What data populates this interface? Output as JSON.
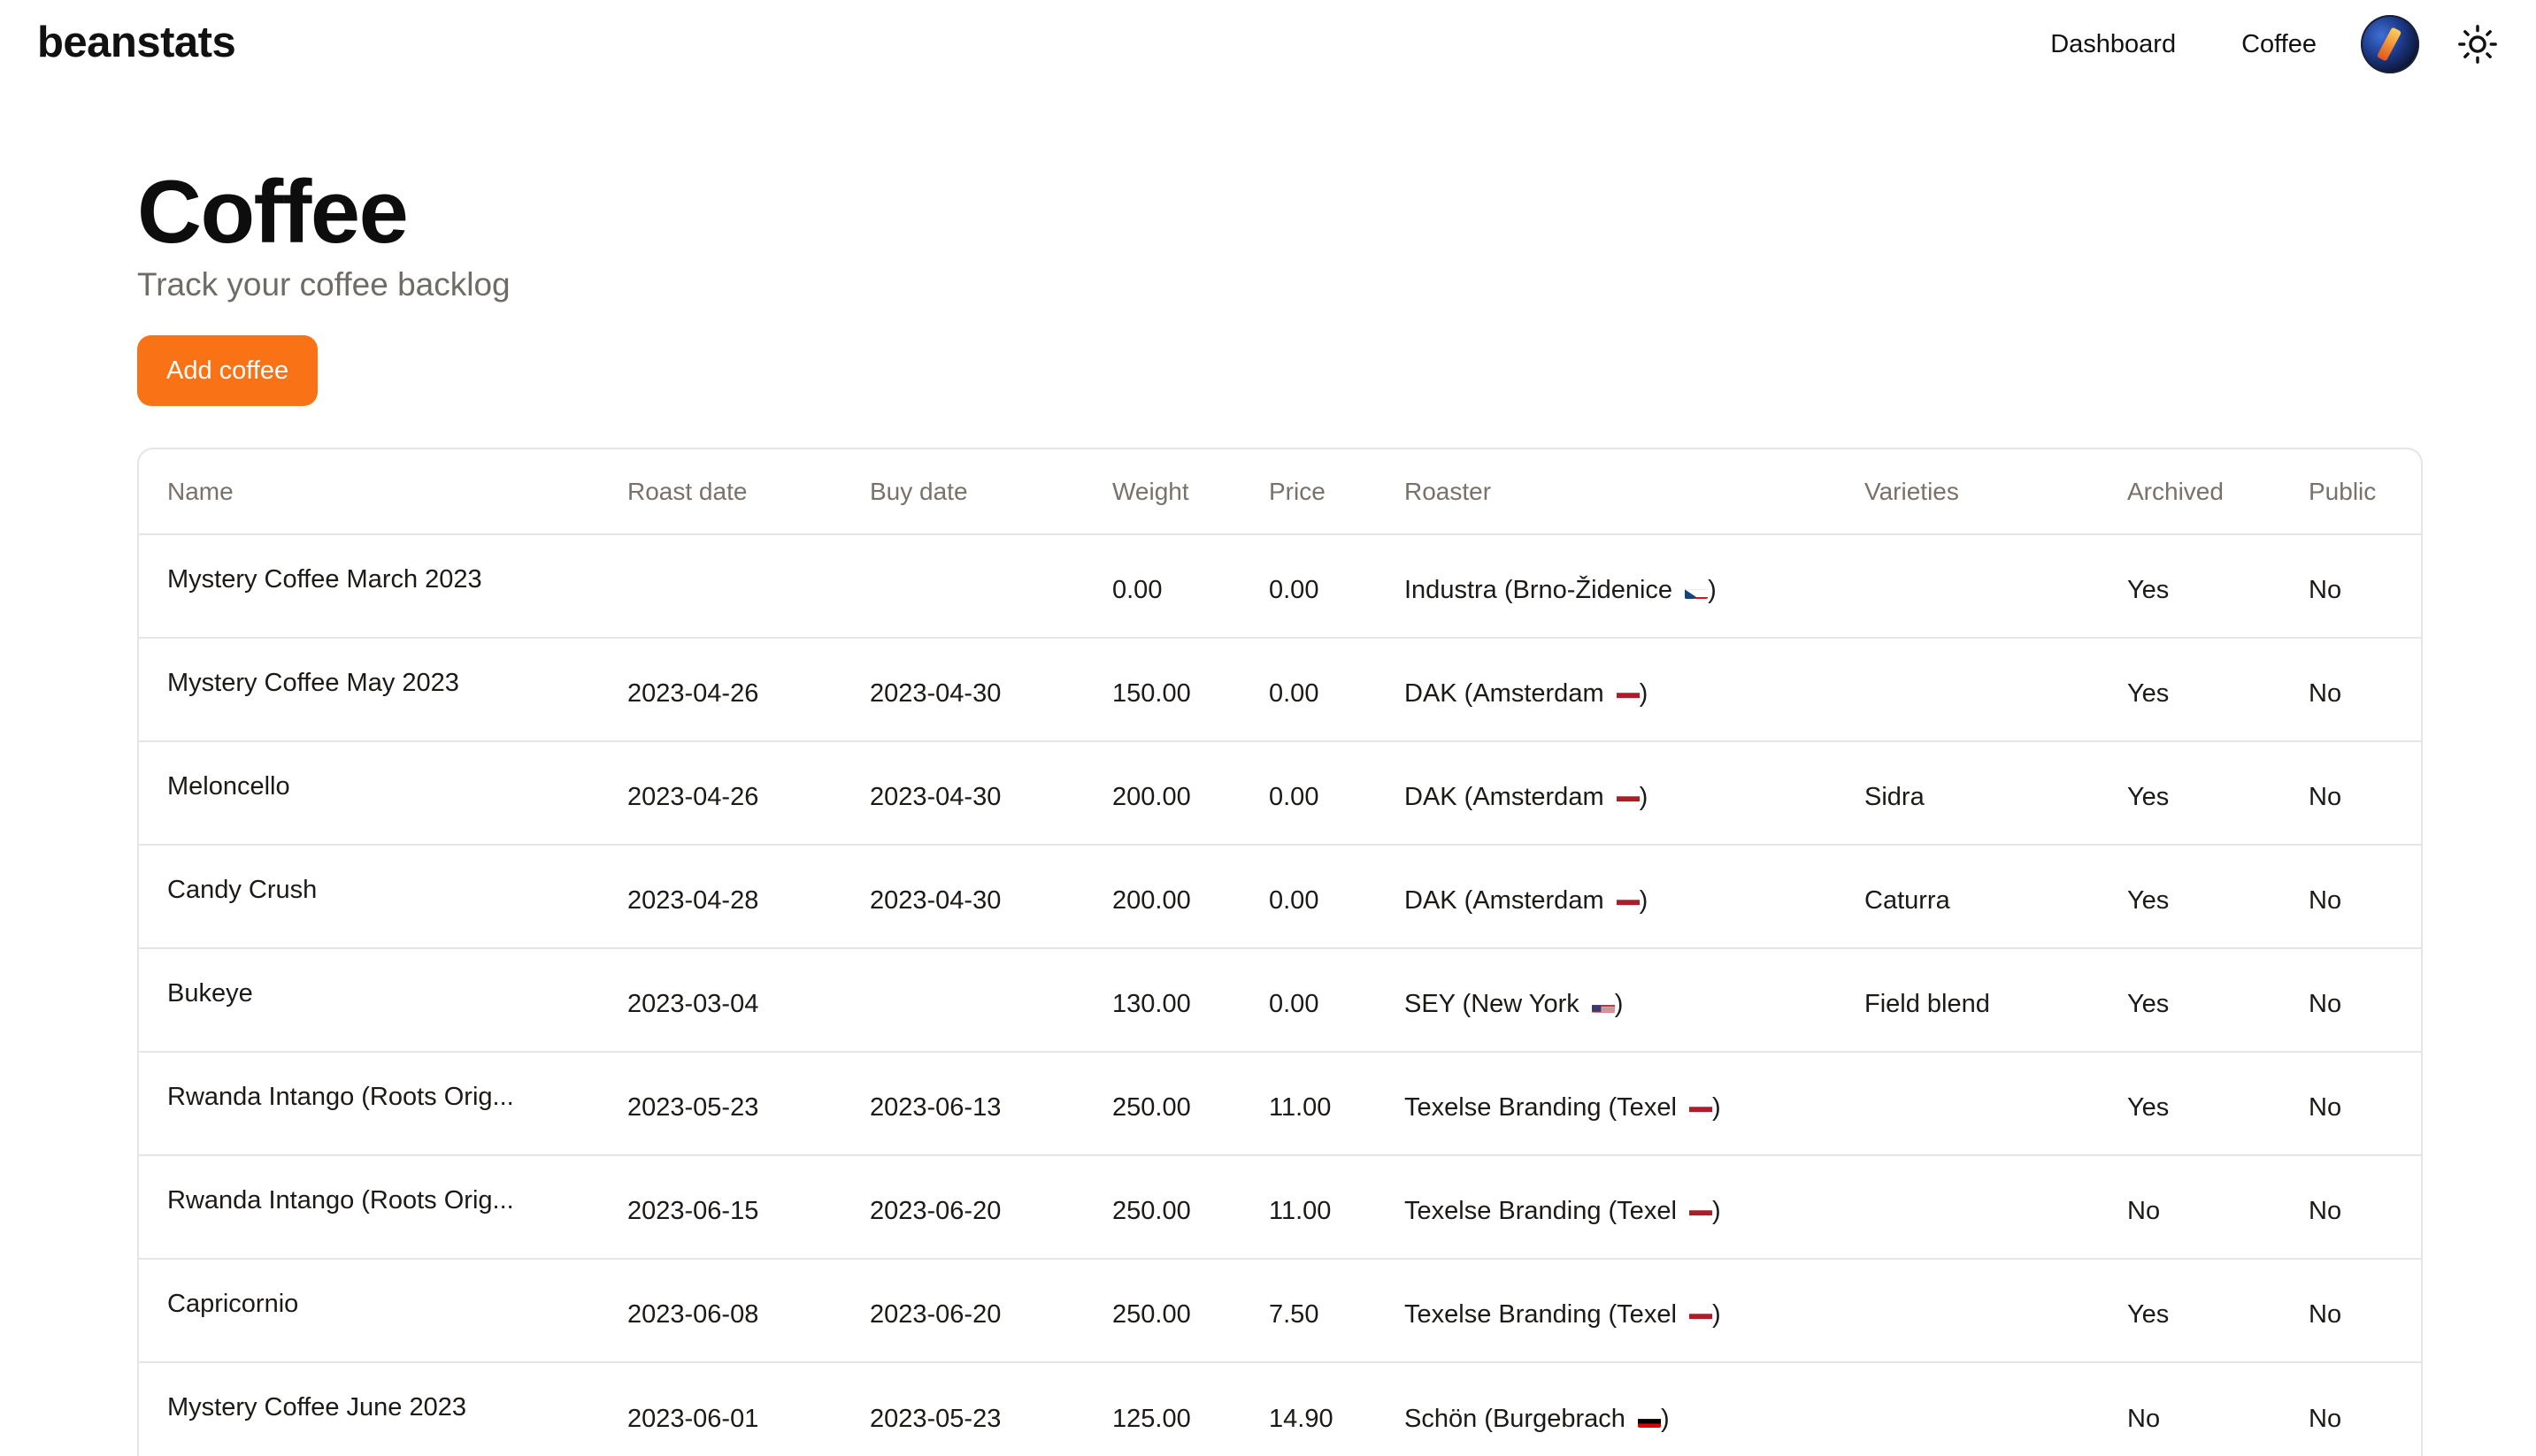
{
  "app": {
    "brand": "beanstats"
  },
  "nav": {
    "dashboard": "Dashboard",
    "coffee": "Coffee"
  },
  "icons": {
    "avatar": "user-avatar",
    "theme": "sun-icon"
  },
  "page": {
    "title": "Coffee",
    "subtitle": "Track your coffee backlog",
    "add_button": "Add coffee"
  },
  "colors": {
    "accent": "#f97316",
    "border": "#e7e5e4",
    "muted": "#78716c"
  },
  "table": {
    "headers": [
      "Name",
      "Roast date",
      "Buy date",
      "Weight",
      "Price",
      "Roaster",
      "Varieties",
      "Archived",
      "Public"
    ],
    "rows": [
      {
        "name": "Mystery Coffee March 2023",
        "roast": "",
        "buy": "",
        "weight": "0.00",
        "price": "0.00",
        "roaster": "Industra (Brno-Židenice",
        "flag": "cz",
        "varieties": "",
        "archived": "Yes",
        "public": "No"
      },
      {
        "name": "Mystery Coffee May 2023",
        "roast": "2023-04-26",
        "buy": "2023-04-30",
        "weight": "150.00",
        "price": "0.00",
        "roaster": "DAK (Amsterdam",
        "flag": "nl",
        "varieties": "",
        "archived": "Yes",
        "public": "No"
      },
      {
        "name": "Meloncello",
        "roast": "2023-04-26",
        "buy": "2023-04-30",
        "weight": "200.00",
        "price": "0.00",
        "roaster": "DAK (Amsterdam",
        "flag": "nl",
        "varieties": "Sidra",
        "archived": "Yes",
        "public": "No"
      },
      {
        "name": "Candy Crush",
        "roast": "2023-04-28",
        "buy": "2023-04-30",
        "weight": "200.00",
        "price": "0.00",
        "roaster": "DAK (Amsterdam",
        "flag": "nl",
        "varieties": "Caturra",
        "archived": "Yes",
        "public": "No"
      },
      {
        "name": "Bukeye",
        "roast": "2023-03-04",
        "buy": "",
        "weight": "130.00",
        "price": "0.00",
        "roaster": "SEY (New York",
        "flag": "us",
        "varieties": "Field blend",
        "archived": "Yes",
        "public": "No"
      },
      {
        "name": "Rwanda Intango (Roots Orig...",
        "roast": "2023-05-23",
        "buy": "2023-06-13",
        "weight": "250.00",
        "price": "11.00",
        "roaster": "Texelse Branding (Texel",
        "flag": "nl",
        "varieties": "",
        "archived": "Yes",
        "public": "No"
      },
      {
        "name": "Rwanda Intango (Roots Orig...",
        "roast": "2023-06-15",
        "buy": "2023-06-20",
        "weight": "250.00",
        "price": "11.00",
        "roaster": "Texelse Branding (Texel",
        "flag": "nl",
        "varieties": "",
        "archived": "No",
        "public": "No"
      },
      {
        "name": "Capricornio",
        "roast": "2023-06-08",
        "buy": "2023-06-20",
        "weight": "250.00",
        "price": "7.50",
        "roaster": "Texelse Branding (Texel",
        "flag": "nl",
        "varieties": "",
        "archived": "Yes",
        "public": "No"
      },
      {
        "name": "Mystery Coffee June 2023",
        "roast": "2023-06-01",
        "buy": "2023-05-23",
        "weight": "125.00",
        "price": "14.90",
        "roaster": "Schön (Burgebrach",
        "flag": "de",
        "varieties": "",
        "archived": "No",
        "public": "No"
      }
    ]
  }
}
